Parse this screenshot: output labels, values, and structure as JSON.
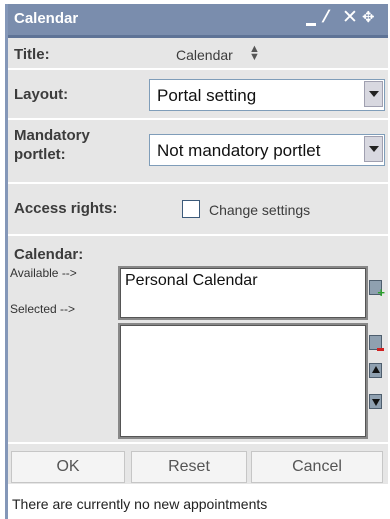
{
  "window": {
    "title": "Calendar"
  },
  "titlebar_icons": [
    "minimize-icon",
    "edit-icon",
    "close-icon",
    "move-icon"
  ],
  "form": {
    "title_label": "Title:",
    "title_value": "Calendar",
    "layout_label": "Layout:",
    "layout_value": "Portal setting",
    "mandatory_label": "Mandatory portlet:",
    "mandatory_value": "Not mandatory portlet",
    "access_label": "Access rights:",
    "access_checkbox_label": "Change settings",
    "access_checked": false,
    "calendar_label": "Calendar:",
    "available_label": "Available -->",
    "selected_label": "Selected -->",
    "available_items": [
      "Personal Calendar"
    ],
    "selected_items": []
  },
  "buttons": {
    "ok": "OK",
    "reset": "Reset",
    "cancel": "Cancel"
  },
  "footer": {
    "message": "There are currently no new appointments"
  },
  "colors": {
    "titlebar": "#7a8dad",
    "panel": "#e6e6e6",
    "border": "#8497b8"
  }
}
